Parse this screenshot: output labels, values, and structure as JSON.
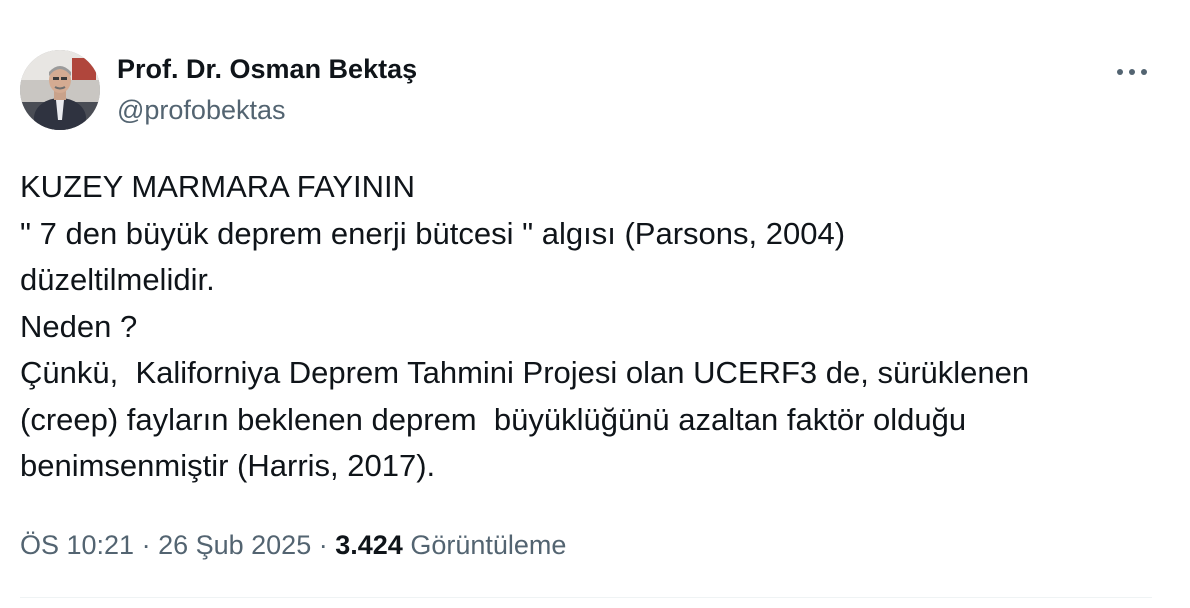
{
  "author": {
    "display_name": "Prof. Dr. Osman Bektaş",
    "handle": "@profobektas"
  },
  "tweet": {
    "lines": [
      "KUZEY MARMARA FAYININ",
      "\" 7 den büyük deprem enerji bütcesi \" algısı (Parsons, 2004)",
      "düzeltilmelidir.",
      "Neden ?",
      "Çünkü,  Kaliforniya Deprem Tahmini Projesi olan UCERF3 de, sürüklenen",
      "(creep) fayların beklenen deprem  büyüklüğünü azaltan faktör olduğu",
      "benimsenmiştir (Harris, 2017)."
    ]
  },
  "meta": {
    "time": "ÖS 10:21",
    "separator": " · ",
    "date": "26 Şub 2025",
    "views_count": "3.424",
    "views_label": "Görüntüleme"
  },
  "icons": {
    "more": "more-horizontal-icon"
  },
  "colors": {
    "primary_text": "#0f1419",
    "secondary_text": "#536471",
    "divider": "#eff3f4"
  }
}
